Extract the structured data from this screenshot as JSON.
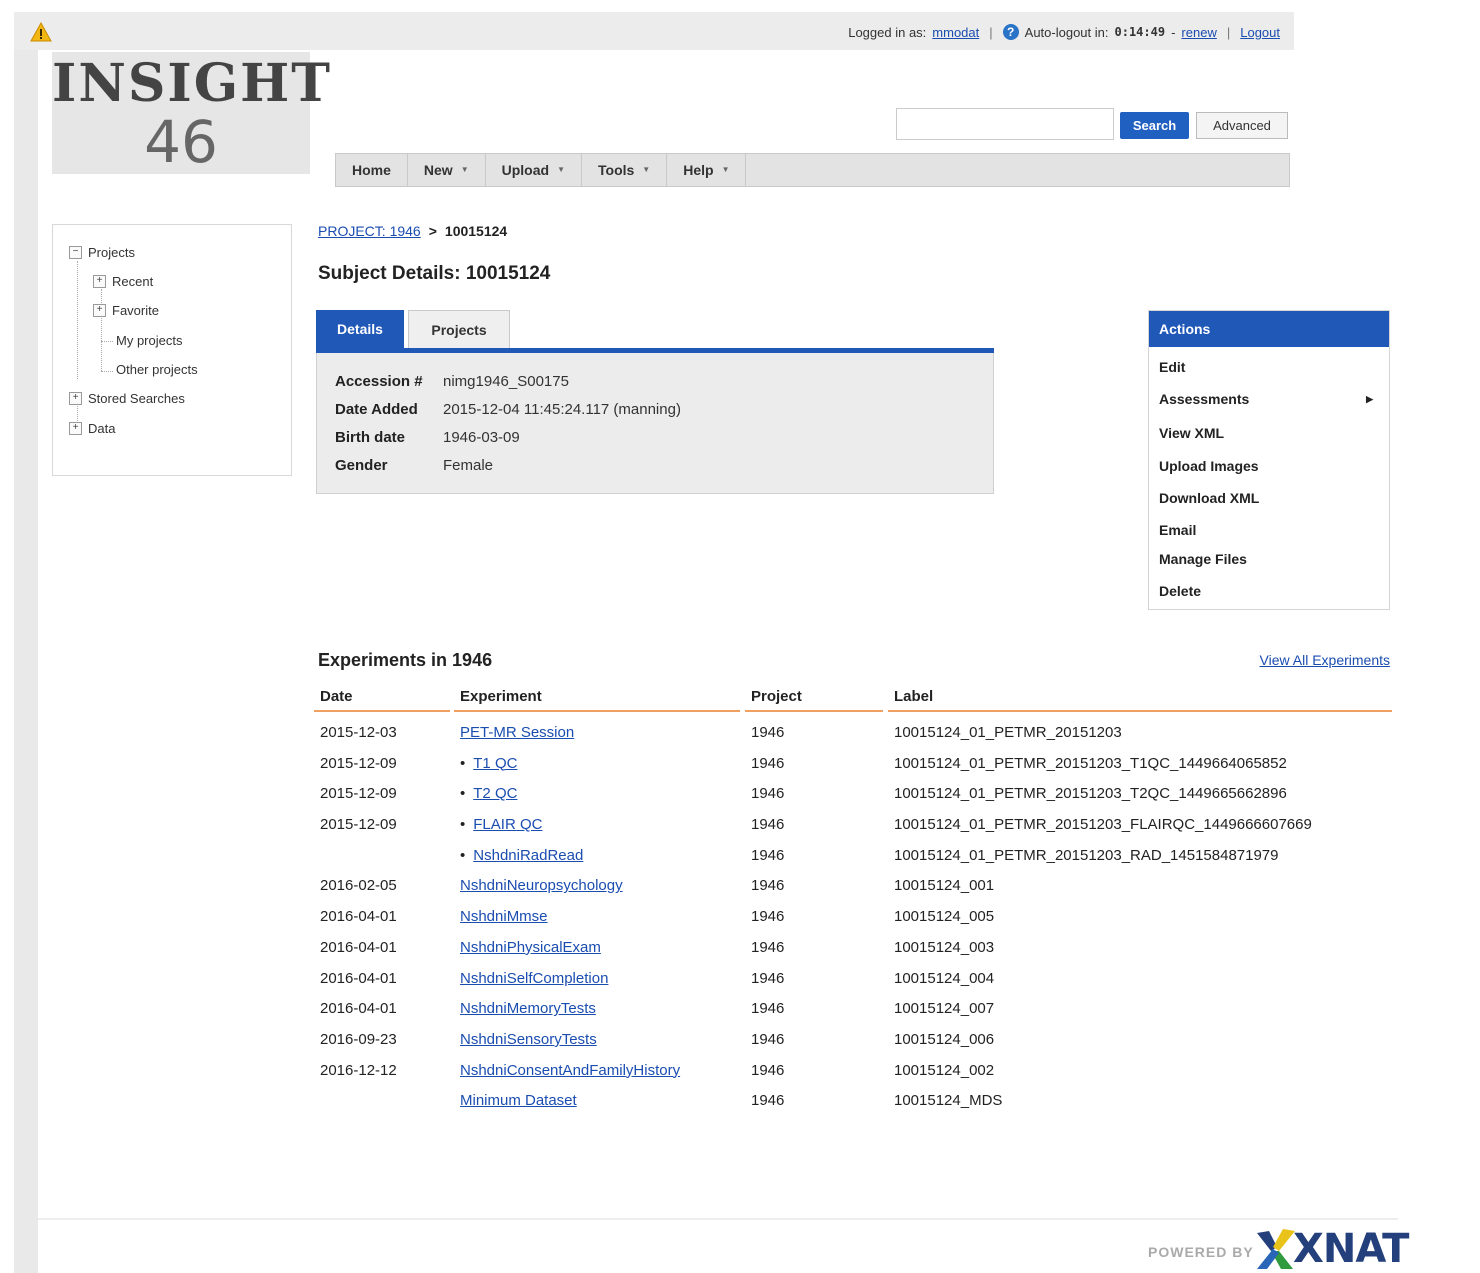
{
  "header": {
    "logged_in_label": "Logged in as:",
    "username": "mmodat",
    "help_glyph": "?",
    "auto_logout_label": "Auto-logout in:",
    "timer": "0:14:49",
    "timer_sep": "-",
    "renew_label": "renew",
    "logout_label": "Logout",
    "separator": "|",
    "warning_icon": "warning-icon"
  },
  "logo": {
    "line1": "INSIGHT",
    "line2": "46"
  },
  "search": {
    "value": "",
    "button_label": "Search",
    "advanced_label": "Advanced"
  },
  "nav": {
    "items": [
      {
        "label": "Home",
        "caret": ""
      },
      {
        "label": "New",
        "caret": "▼"
      },
      {
        "label": "Upload",
        "caret": "▼"
      },
      {
        "label": "Tools",
        "caret": "▼"
      },
      {
        "label": "Help",
        "caret": "▼"
      }
    ]
  },
  "tree": {
    "expand_glyph": "+",
    "collapse_glyph": "−",
    "items": [
      {
        "label": "Projects"
      },
      {
        "label": "Recent"
      },
      {
        "label": "Favorite"
      },
      {
        "label": "My projects"
      },
      {
        "label": "Other projects"
      },
      {
        "label": "Stored Searches"
      },
      {
        "label": "Data"
      }
    ]
  },
  "breadcrumb": {
    "project_link": "PROJECT: 1946",
    "arrow": ">",
    "current": "10015124"
  },
  "page_title": "Subject Details: 10015124",
  "tabs": {
    "details": "Details",
    "projects": "Projects"
  },
  "details": {
    "rows": [
      {
        "key": "Accession #",
        "value": "nimg1946_S00175"
      },
      {
        "key": "Date Added",
        "value": "2015-12-04 11:45:24.117 (manning)"
      },
      {
        "key": "Birth date",
        "value": "1946-03-09"
      },
      {
        "key": "Gender",
        "value": "Female"
      }
    ]
  },
  "actions": {
    "title": "Actions",
    "submenu_glyph": "▶",
    "items": [
      {
        "label": "Edit"
      },
      {
        "label": "Assessments"
      },
      {
        "label": "View XML"
      },
      {
        "label": "Upload Images"
      },
      {
        "label": "Download XML"
      },
      {
        "label": "Email"
      },
      {
        "label": "Manage Files"
      },
      {
        "label": "Delete"
      }
    ]
  },
  "experiments": {
    "title": "Experiments in 1946",
    "view_all": "View All Experiments",
    "columns": [
      "Date",
      "Experiment",
      "Project",
      "Label"
    ],
    "bullet": "•",
    "rows": [
      {
        "date": "2015-12-03",
        "experiment": "PET-MR Session",
        "bullet": false,
        "project": "1946",
        "label": "10015124_01_PETMR_20151203"
      },
      {
        "date": "2015-12-09",
        "experiment": "T1 QC",
        "bullet": true,
        "project": "1946",
        "label": "10015124_01_PETMR_20151203_T1QC_1449664065852"
      },
      {
        "date": "2015-12-09",
        "experiment": "T2 QC",
        "bullet": true,
        "project": "1946",
        "label": "10015124_01_PETMR_20151203_T2QC_1449665662896"
      },
      {
        "date": "2015-12-09",
        "experiment": "FLAIR QC",
        "bullet": true,
        "project": "1946",
        "label": "10015124_01_PETMR_20151203_FLAIRQC_1449666607669"
      },
      {
        "date": "",
        "experiment": "NshdniRadRead",
        "bullet": true,
        "project": "1946",
        "label": "10015124_01_PETMR_20151203_RAD_1451584871979"
      },
      {
        "date": "2016-02-05",
        "experiment": "NshdniNeuropsychology",
        "bullet": false,
        "project": "1946",
        "label": "10015124_001"
      },
      {
        "date": "2016-04-01",
        "experiment": "NshdniMmse",
        "bullet": false,
        "project": "1946",
        "label": "10015124_005"
      },
      {
        "date": "2016-04-01",
        "experiment": "NshdniPhysicalExam",
        "bullet": false,
        "project": "1946",
        "label": "10015124_003"
      },
      {
        "date": "2016-04-01",
        "experiment": "NshdniSelfCompletion",
        "bullet": false,
        "project": "1946",
        "label": "10015124_004"
      },
      {
        "date": "2016-04-01",
        "experiment": "NshdniMemoryTests",
        "bullet": false,
        "project": "1946",
        "label": "10015124_007"
      },
      {
        "date": "2016-09-23",
        "experiment": "NshdniSensoryTests",
        "bullet": false,
        "project": "1946",
        "label": "10015124_006"
      },
      {
        "date": "2016-12-12",
        "experiment": "NshdniConsentAndFamilyHistory",
        "bullet": false,
        "project": "1946",
        "label": "10015124_002"
      },
      {
        "date": "",
        "experiment": "Minimum Dataset",
        "bullet": false,
        "project": "1946",
        "label": "10015124_MDS"
      }
    ]
  },
  "footer": {
    "powered_by": "POWERED BY",
    "brand": "XNAT"
  },
  "colors": {
    "accent": "#2058b8",
    "link": "#1a4db0",
    "table_rule": "#f0a060",
    "panel_bg": "#ececec"
  }
}
